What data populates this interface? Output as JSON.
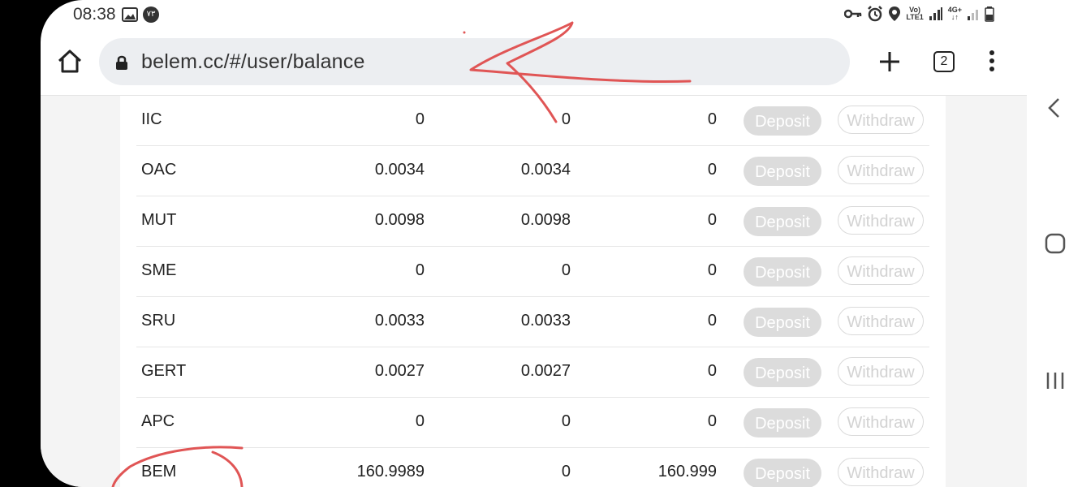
{
  "status": {
    "time": "08:38",
    "volte_top": "Vo)",
    "volte_bottom": "LTE1",
    "net_top": "4G+",
    "net_bottom": "↓↑",
    "left_badge": "٧٣"
  },
  "browser": {
    "url": "belem.cc/#/user/balance",
    "tab_count": "2"
  },
  "balances": {
    "deposit_label": "Deposit",
    "withdraw_label": "Withdraw",
    "rows": [
      {
        "coin": "IIC",
        "total": "0",
        "available": "0",
        "frozen": "0"
      },
      {
        "coin": "OAC",
        "total": "0.0034",
        "available": "0.0034",
        "frozen": "0"
      },
      {
        "coin": "MUT",
        "total": "0.0098",
        "available": "0.0098",
        "frozen": "0"
      },
      {
        "coin": "SME",
        "total": "0",
        "available": "0",
        "frozen": "0"
      },
      {
        "coin": "SRU",
        "total": "0.0033",
        "available": "0.0033",
        "frozen": "0"
      },
      {
        "coin": "GERT",
        "total": "0.0027",
        "available": "0.0027",
        "frozen": "0"
      },
      {
        "coin": "APC",
        "total": "0",
        "available": "0",
        "frozen": "0"
      },
      {
        "coin": "BEM",
        "total": "160.9989",
        "available": "0",
        "frozen": "160.999"
      }
    ]
  },
  "icons": {
    "home": "home-icon",
    "lock": "lock-icon",
    "new_tab": "plus-icon",
    "menu": "more-vert-icon",
    "back": "back-chevron-icon",
    "home_nav": "home-square-icon",
    "recents": "recents-icon"
  },
  "colors": {
    "annotation": "#e05555",
    "deposit_bg": "#dcdcdc",
    "withdraw_text": "#d2d2d2"
  }
}
